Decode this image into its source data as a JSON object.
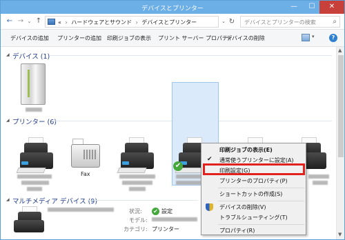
{
  "window": {
    "title": "デバイスとプリンター"
  },
  "titlebar_buttons": {
    "minimize": "—",
    "maximize": "☐",
    "close": "✕"
  },
  "address": {
    "back": "←",
    "forward": "→",
    "recent": "⌄",
    "up": "↑",
    "overflow": "«",
    "crumbs": [
      "ハードウェアとサウンド",
      "デバイスとプリンター"
    ],
    "separator": "›",
    "dropdown": "⌄",
    "refresh": "↻",
    "search_placeholder": "デバイスとプリンターの検索",
    "search_icon": "⌕"
  },
  "commands": {
    "add_device": "デバイスの追加",
    "add_printer": "プリンターの追加",
    "print_jobs": "印刷ジョブの表示",
    "print_server": "プリント サーバー プロパティ",
    "remove_device": "デバイスの削除",
    "view_dropdown": "▾",
    "help": "?"
  },
  "groups": {
    "devices": "デバイス (1)",
    "printers": "プリンター (6)",
    "multimedia": "マルチメディア デバイス (9)"
  },
  "printers": {
    "fax_label": "Fax"
  },
  "details": {
    "status_label": "状況:",
    "status_value": "設定",
    "model_label": "モデル:",
    "category_label": "カテゴリ:",
    "category_value": "プリンター"
  },
  "context_menu": {
    "items": [
      {
        "label": "印刷ジョブの表示(E)",
        "bold": true
      },
      {
        "label": "通常使うプリンターに設定(A)",
        "checked": true
      },
      {
        "label": "印刷設定(G)",
        "highlighted": true
      },
      {
        "label": "プリンターのプロパティ(P)"
      },
      {
        "label": "ショートカットの作成(S)"
      },
      {
        "label": "デバイスの削除(V)",
        "shield": true
      },
      {
        "label": "トラブルシューティング(T)"
      },
      {
        "label": "プロパティ(R)"
      }
    ],
    "check_glyph": "✔"
  },
  "icons": {
    "computer": "computer-icon",
    "printer": "printer-icon",
    "fax": "fax-icon",
    "default_check": "✔"
  },
  "colors": {
    "titlebar": "#6caee6",
    "group_title": "#1e3a8a",
    "selection": "#dbeafa",
    "highlight_box": "#e0211d",
    "status_ok": "#45a83c"
  }
}
